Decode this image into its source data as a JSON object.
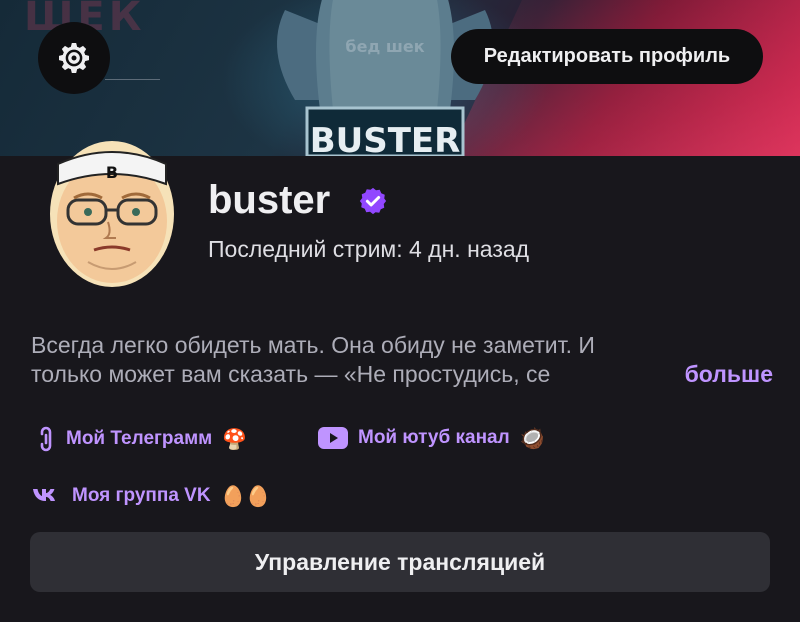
{
  "banner": {
    "bg_text": "ШЕК",
    "mascot_text": "BUSTER",
    "mascot_shirt_text": "бед шек"
  },
  "header": {
    "settings_icon": "gear-icon",
    "edit_profile_label": "Редактировать профиль"
  },
  "profile": {
    "avatar_headband_letter": "B",
    "channel_name": "buster",
    "verified_icon": "verified-badge-icon",
    "last_stream": "Последний стрим: 4 дн. назад"
  },
  "bio": {
    "line1": "Всегда легко обидеть мать. Она обиду не заметит. И",
    "line2": "только может вам сказать — «Не простудись, се",
    "more_label": "больше"
  },
  "links": [
    {
      "label": "Мой Телеграмм",
      "emoji": "🍄",
      "icon": "link-icon"
    },
    {
      "label": "Мой ютуб канал",
      "emoji": "🥥",
      "icon": "youtube-icon"
    },
    {
      "label": "Моя группа VK",
      "emoji": "🥚🥚",
      "icon": "vk-icon"
    }
  ],
  "actions": {
    "manage_stream_label": "Управление трансляцией"
  },
  "colors": {
    "accent": "#bf94ff",
    "background": "#18171c",
    "button_bg": "#2f2f35",
    "verified": "#9147ff"
  }
}
